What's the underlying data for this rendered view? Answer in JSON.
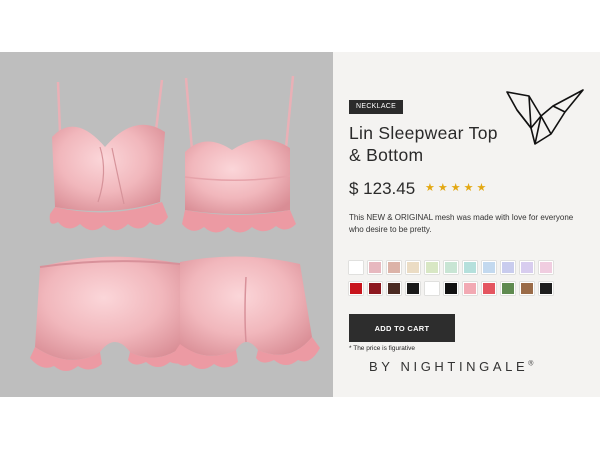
{
  "product": {
    "badge": "NECKLACE",
    "title": "Lin Sleepwear Top & Bottom",
    "price": "$ 123.45",
    "rating": 5,
    "description": "This NEW & ORIGINAL mesh was made with love for everyone who desire to be pretty.",
    "cart_label": "ADD TO CART",
    "note": "* The price is figurative",
    "brand": "BY NIGHTINGALE",
    "brand_mark": "®"
  },
  "swatches": [
    "#ffffff",
    "#e7b8bf",
    "#dcb3a8",
    "#ebdcc4",
    "#d8e7c4",
    "#c8e5d4",
    "#b5e0dc",
    "#c3d9ef",
    "#c9ccee",
    "#d8cdef",
    "#f0cde0",
    "#c8141c",
    "#8d1820",
    "#4a2a22",
    "#1a1a1a",
    "#ffffff",
    "#111111",
    "#f2a9b3",
    "#e45560",
    "#5f8a50",
    "#9a6b48",
    "#1e1e1e"
  ],
  "colors": {
    "photo_bg": "#bebebe",
    "garment": "#f1b7bc",
    "star": "#e3a812",
    "button": "#2d2d2d"
  },
  "icons": {
    "star": "star-icon",
    "logo": "origami-bird-logo"
  }
}
